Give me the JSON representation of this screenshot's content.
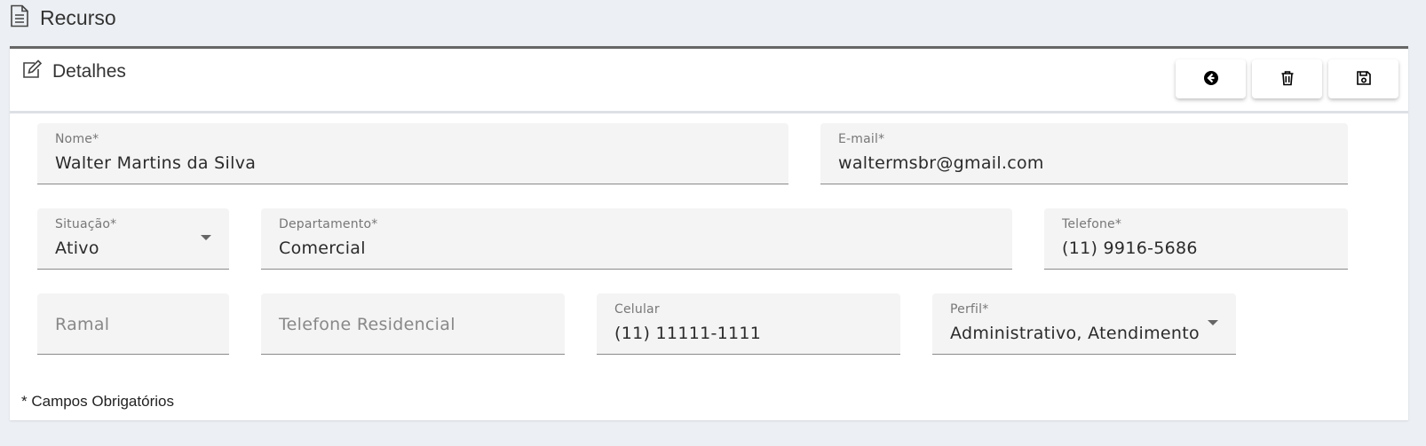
{
  "header": {
    "title": "Recurso",
    "icon": "document-icon"
  },
  "card": {
    "title": "Detalhes",
    "icon": "edit-icon",
    "toolbar": [
      {
        "name": "back-button",
        "icon": "arrow-left-circle-icon"
      },
      {
        "name": "delete-button",
        "icon": "trash-icon"
      },
      {
        "name": "save-button",
        "icon": "floppy-disk-icon"
      }
    ]
  },
  "form": {
    "nome": {
      "label": "Nome*",
      "value": "Walter Martins da Silva"
    },
    "email": {
      "label": "E-mail*",
      "value": "waltermsbr@gmail.com"
    },
    "situacao": {
      "label": "Situação*",
      "value": "Ativo"
    },
    "departamento": {
      "label": "Departamento*",
      "value": "Comercial"
    },
    "telefone": {
      "label": "Telefone*",
      "value": "(11) 9916-5686"
    },
    "ramal": {
      "placeholder": "Ramal"
    },
    "telefone_residencial": {
      "placeholder": "Telefone Residencial"
    },
    "celular": {
      "label": "Celular",
      "value": "(11) 11111-1111"
    },
    "perfil": {
      "label": "Perfil*",
      "value": "Administrativo, Atendimento"
    }
  },
  "footer_note": "* Campos Obrigatórios"
}
